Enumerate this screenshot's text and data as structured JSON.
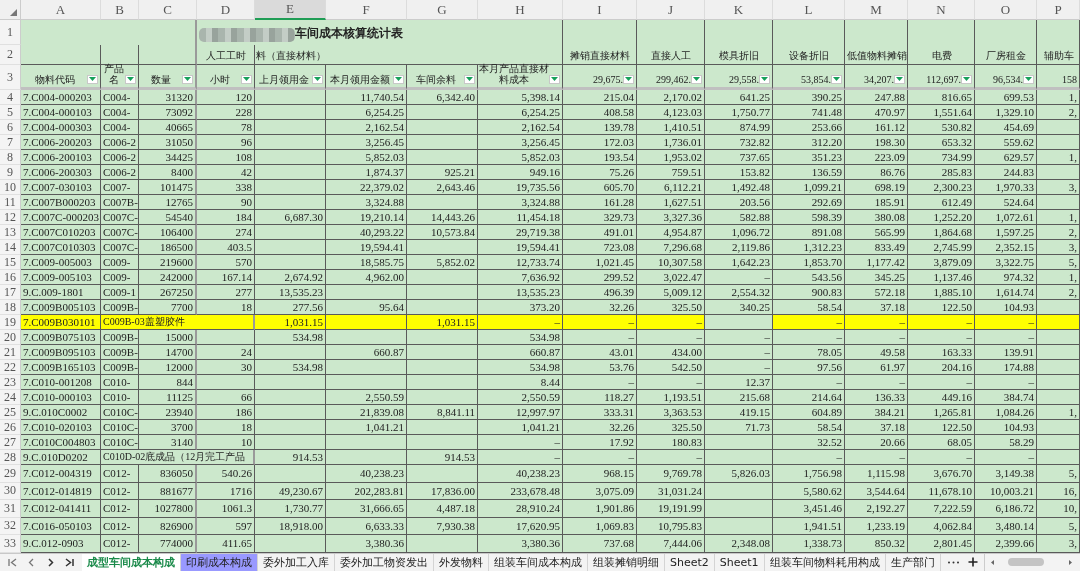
{
  "columns": [
    {
      "label": "A",
      "selected": false
    },
    {
      "label": "B",
      "selected": false
    },
    {
      "label": "C",
      "selected": false
    },
    {
      "label": "D",
      "selected": false
    },
    {
      "label": "E",
      "selected": true
    },
    {
      "label": "F",
      "selected": false
    },
    {
      "label": "G",
      "selected": false
    },
    {
      "label": "H",
      "selected": false
    },
    {
      "label": "I",
      "selected": false
    },
    {
      "label": "J",
      "selected": false
    },
    {
      "label": "K",
      "selected": false
    },
    {
      "label": "L",
      "selected": false
    },
    {
      "label": "M",
      "selected": false
    },
    {
      "label": "N",
      "selected": false
    },
    {
      "label": "O",
      "selected": false
    },
    {
      "label": "P",
      "selected": false
    }
  ],
  "title_row": {
    "number": "1",
    "title": "车间成本核算统计表"
  },
  "group_row": {
    "number": "2",
    "cells": {
      "D": "人工工时",
      "E": "料（直接材料）",
      "I": "摊销直接材料",
      "J": "直接人工",
      "K": "模具折旧",
      "L": "设备折旧",
      "M": "低值物料摊销",
      "N": "电费",
      "O": "厂房租金",
      "P": "辅助车"
    }
  },
  "header_row": {
    "number": "3",
    "cells": {
      "A": {
        "text": "物料代码",
        "filter": true
      },
      "B": {
        "text": "产品名",
        "filter": true
      },
      "C": {
        "text": "数量",
        "filter": true
      },
      "D": {
        "text": "小时",
        "filter": true
      },
      "E": {
        "text": "上月领用金",
        "filter": true
      },
      "F": {
        "text": "本月领用金额",
        "filter": true
      },
      "G": {
        "text": "车间余料",
        "filter": true
      },
      "H": {
        "text": "本月产品直接材料成本",
        "filter": true
      },
      "I": {
        "text": "29,675.",
        "filter": true
      },
      "J": {
        "text": "299,462.",
        "filter": true
      },
      "K": {
        "text": "29,558.",
        "filter": true
      },
      "L": {
        "text": "53,854.",
        "filter": true
      },
      "M": {
        "text": "34,207.",
        "filter": true
      },
      "N": {
        "text": "112,697.",
        "filter": true
      },
      "O": {
        "text": "96,534.",
        "filter": true
      },
      "P": {
        "text": "158",
        "filter": false
      }
    }
  },
  "rows": [
    {
      "number": "4",
      "cells": {
        "A": "7.C004-000203",
        "B": "C004-",
        "C": "31320",
        "D": "120",
        "F": "11,740.54",
        "G": "6,342.40",
        "H": "5,398.14",
        "I": "215.04",
        "J": "2,170.02",
        "K": "641.25",
        "L": "390.25",
        "M": "247.88",
        "N": "816.65",
        "O": "699.53",
        "P": "1,"
      }
    },
    {
      "number": "5",
      "cells": {
        "A": "7.C004-000103",
        "B": "C004-",
        "C": "73092",
        "D": "228",
        "F": "6,254.25",
        "H": "6,254.25",
        "I": "408.58",
        "J": "4,123.03",
        "K": "1,750.77",
        "L": "741.48",
        "M": "470.97",
        "N": "1,551.64",
        "O": "1,329.10",
        "P": "2,"
      }
    },
    {
      "number": "6",
      "cells": {
        "A": "7.C004-000303",
        "B": "C004-",
        "C": "40665",
        "D": "78",
        "F": "2,162.54",
        "H": "2,162.54",
        "I": "139.78",
        "J": "1,410.51",
        "K": "874.99",
        "L": "253.66",
        "M": "161.12",
        "N": "530.82",
        "O": "454.69"
      }
    },
    {
      "number": "7",
      "cells": {
        "A": "7.C006-200203",
        "B": "C006-2",
        "C": "31050",
        "D": "96",
        "F": "3,256.45",
        "H": "3,256.45",
        "I": "172.03",
        "J": "1,736.01",
        "K": "732.82",
        "L": "312.20",
        "M": "198.30",
        "N": "653.32",
        "O": "559.62"
      }
    },
    {
      "number": "8",
      "cells": {
        "A": "7.C006-200103",
        "B": "C006-2",
        "C": "34425",
        "D": "108",
        "F": "5,852.03",
        "H": "5,852.03",
        "I": "193.54",
        "J": "1,953.02",
        "K": "737.65",
        "L": "351.23",
        "M": "223.09",
        "N": "734.99",
        "O": "629.57",
        "P": "1,"
      }
    },
    {
      "number": "9",
      "cells": {
        "A": "7.C006-200303",
        "B": "C006-2",
        "C": "8400",
        "D": "42",
        "F": "1,874.37",
        "G": "925.21",
        "H": "949.16",
        "I": "75.26",
        "J": "759.51",
        "K": "153.82",
        "L": "136.59",
        "M": "86.76",
        "N": "285.83",
        "O": "244.83"
      }
    },
    {
      "number": "10",
      "cells": {
        "A": "7.C007-030103",
        "B": "C007-",
        "C": "101475",
        "D": "338",
        "F": "22,379.02",
        "G": "2,643.46",
        "H": "19,735.56",
        "I": "605.70",
        "J": "6,112.21",
        "K": "1,492.48",
        "L": "1,099.21",
        "M": "698.19",
        "N": "2,300.23",
        "O": "1,970.33",
        "P": "3,"
      }
    },
    {
      "number": "11",
      "cells": {
        "A": "7.C007B000203",
        "B": "C007B-",
        "C": "12765",
        "D": "90",
        "F": "3,324.88",
        "H": "3,324.88",
        "I": "161.28",
        "J": "1,627.51",
        "K": "203.56",
        "L": "292.69",
        "M": "185.91",
        "N": "612.49",
        "O": "524.64"
      }
    },
    {
      "number": "12",
      "cells": {
        "A": "7.C007C-000203",
        "B": "C007C-",
        "C": "54540",
        "D": "184",
        "E": "6,687.30",
        "F": "19,210.14",
        "G": "14,443.26",
        "H": "11,454.18",
        "I": "329.73",
        "J": "3,327.36",
        "K": "582.88",
        "L": "598.39",
        "M": "380.08",
        "N": "1,252.20",
        "O": "1,072.61",
        "P": "1,"
      }
    },
    {
      "number": "13",
      "cells": {
        "A": "7.C007C010203",
        "B": "C007C-",
        "C": "106400",
        "D": "274",
        "F": "40,293.22",
        "G": "10,573.84",
        "H": "29,719.38",
        "I": "491.01",
        "J": "4,954.87",
        "K": "1,096.72",
        "L": "891.08",
        "M": "565.99",
        "N": "1,864.68",
        "O": "1,597.25",
        "P": "2,"
      }
    },
    {
      "number": "14",
      "cells": {
        "A": "7.C007C010303",
        "B": "C007C-",
        "C": "186500",
        "D": "403.5",
        "F": "19,594.41",
        "H": "19,594.41",
        "I": "723.08",
        "J": "7,296.68",
        "K": "2,119.86",
        "L": "1,312.23",
        "M": "833.49",
        "N": "2,745.99",
        "O": "2,352.15",
        "P": "3,"
      }
    },
    {
      "number": "15",
      "cells": {
        "A": "7.C009-005003",
        "B": "C009-",
        "C": "219600",
        "D": "570",
        "F": "18,585.75",
        "G": "5,852.02",
        "H": "12,733.74",
        "I": "1,021.45",
        "J": "10,307.58",
        "K": "1,642.23",
        "L": "1,853.70",
        "M": "1,177.42",
        "N": "3,879.09",
        "O": "3,322.75",
        "P": "5,"
      }
    },
    {
      "number": "16",
      "cells": {
        "A": "7.C009-005103",
        "B": "C009-",
        "C": "242000",
        "D": "167.14",
        "E": "2,674.92",
        "F": "4,962.00",
        "H": "7,636.92",
        "I": "299.52",
        "J": "3,022.47",
        "K": "–",
        "L": "543.56",
        "M": "345.25",
        "N": "1,137.46",
        "O": "974.32",
        "P": "1,"
      }
    },
    {
      "number": "17",
      "cells": {
        "A": "9.C.009-1801",
        "B": "C009-1",
        "C": "267250",
        "D": "277",
        "E": "13,535.23",
        "H": "13,535.23",
        "I": "496.39",
        "J": "5,009.12",
        "K": "2,554.32",
        "L": "900.83",
        "M": "572.18",
        "N": "1,885.10",
        "O": "1,614.74",
        "P": "2,"
      }
    },
    {
      "number": "18",
      "cells": {
        "A": "7.C009B005103",
        "B": "C009B-",
        "C": "7700",
        "D": "18",
        "E": "277.56",
        "F": "95.64",
        "H": "373.20",
        "I": "32.26",
        "J": "325.50",
        "K": "340.25",
        "L": "58.54",
        "M": "37.18",
        "N": "122.50",
        "O": "104.93"
      }
    },
    {
      "number": "19",
      "cells": {
        "A": "7.C009B030101",
        "B": "C009B-03盖塑胶件",
        "E": "1,031.15",
        "G": "1,031.15",
        "H": "–",
        "I": "–",
        "J": "–",
        "L": "–",
        "M": "–",
        "N": "–",
        "O": "–"
      },
      "highlighted_cells": {
        "A": true,
        "B": true,
        "E": true,
        "F": true,
        "G": true,
        "H": true,
        "I": true,
        "J": true,
        "K": false,
        "L": true,
        "M": true,
        "N": true,
        "O": true,
        "P": true
      }
    },
    {
      "number": "20",
      "cells": {
        "A": "7.C009B075103",
        "B": "C009B-",
        "C": "15000",
        "E": "534.98",
        "H": "534.98",
        "I": "–",
        "J": "–",
        "K": "–",
        "L": "–",
        "M": "–",
        "N": "–",
        "O": "–"
      }
    },
    {
      "number": "21",
      "cells": {
        "A": "7.C009B095103",
        "B": "C009B-",
        "C": "14700",
        "D": "24",
        "F": "660.87",
        "H": "660.87",
        "I": "43.01",
        "J": "434.00",
        "K": "–",
        "L": "78.05",
        "M": "49.58",
        "N": "163.33",
        "O": "139.91"
      }
    },
    {
      "number": "22",
      "cells": {
        "A": "7.C009B165103",
        "B": "C009B-",
        "C": "12000",
        "D": "30",
        "E": "534.98",
        "H": "534.98",
        "I": "53.76",
        "J": "542.50",
        "K": "–",
        "L": "97.56",
        "M": "61.97",
        "N": "204.16",
        "O": "174.88"
      }
    },
    {
      "number": "23",
      "cells": {
        "A": "7.C010-001208",
        "B": "C010-",
        "C": "844",
        "H": "8.44",
        "I": "–",
        "J": "–",
        "K": "12.37",
        "L": "–",
        "M": "–",
        "N": "–",
        "O": "–"
      }
    },
    {
      "number": "24",
      "cells": {
        "A": "7.C010-000103",
        "B": "C010-",
        "C": "11125",
        "D": "66",
        "F": "2,550.59",
        "H": "2,550.59",
        "I": "118.27",
        "J": "1,193.51",
        "K": "215.68",
        "L": "214.64",
        "M": "136.33",
        "N": "449.16",
        "O": "384.74"
      }
    },
    {
      "number": "25",
      "cells": {
        "A": "9.C.010C0002",
        "B": "C010C-",
        "C": "23940",
        "D": "186",
        "F": "21,839.08",
        "G": "8,841.11",
        "H": "12,997.97",
        "I": "333.31",
        "J": "3,363.53",
        "K": "419.15",
        "L": "604.89",
        "M": "384.21",
        "N": "1,265.81",
        "O": "1,084.26",
        "P": "1,"
      }
    },
    {
      "number": "26",
      "cells": {
        "A": "7.C010-020103",
        "B": "C010C-",
        "C": "3700",
        "D": "18",
        "F": "1,041.21",
        "H": "1,041.21",
        "I": "32.26",
        "J": "325.50",
        "K": "71.73",
        "L": "58.54",
        "M": "37.18",
        "N": "122.50",
        "O": "104.93"
      }
    },
    {
      "number": "27",
      "cells": {
        "A": "7.C010C004803",
        "B": "C010C-",
        "C": "3140",
        "D": "10",
        "H": "–",
        "I": "17.92",
        "J": "180.83",
        "L": "32.52",
        "M": "20.66",
        "N": "68.05",
        "O": "58.29"
      }
    },
    {
      "number": "28",
      "cells": {
        "A": "9.C.010D0202",
        "B": "C010D-02底成品（12月完工产品",
        "E": "914.53",
        "G": "914.53",
        "H": "–",
        "I": "–",
        "J": "–",
        "L": "–",
        "M": "–",
        "N": "–",
        "O": "–"
      }
    },
    {
      "number": "29",
      "cells": {
        "A": "7.C012-004319",
        "B": "C012-",
        "C": "836050",
        "D": "540.26",
        "F": "40,238.23",
        "H": "40,238.23",
        "I": "968.15",
        "J": "9,769.78",
        "K": "5,826.03",
        "L": "1,756.98",
        "M": "1,115.98",
        "N": "3,676.70",
        "O": "3,149.38",
        "P": "5,"
      }
    },
    {
      "number": "30",
      "cells": {
        "A": "7.C012-014819",
        "B": "C012-",
        "C": "881677",
        "D": "1716",
        "E": "49,230.67",
        "F": "202,283.81",
        "G": "17,836.00",
        "H": "233,678.48",
        "I": "3,075.09",
        "J": "31,031.24",
        "L": "5,580.62",
        "M": "3,544.64",
        "N": "11,678.10",
        "O": "10,003.21",
        "P": "16,"
      }
    },
    {
      "number": "31",
      "cells": {
        "A": "7.C012-041411",
        "B": "C012-",
        "C": "1027800",
        "D": "1061.3",
        "E": "1,730.77",
        "F": "31,666.65",
        "G": "4,487.18",
        "H": "28,910.24",
        "I": "1,901.86",
        "J": "19,191.99",
        "L": "3,451.46",
        "M": "2,192.27",
        "N": "7,222.59",
        "O": "6,186.72",
        "P": "10,"
      }
    },
    {
      "number": "32",
      "cells": {
        "A": "7.C016-050103",
        "B": "C012-",
        "C": "826900",
        "D": "597",
        "E": "18,918.00",
        "F": "6,633.33",
        "G": "7,930.38",
        "H": "17,620.95",
        "I": "1,069.83",
        "J": "10,795.83",
        "L": "1,941.51",
        "M": "1,233.19",
        "N": "4,062.84",
        "O": "3,480.14",
        "P": "5,"
      }
    },
    {
      "number": "33",
      "cells": {
        "A": "9.C.012-0903",
        "B": "C012-",
        "C": "774000",
        "D": "411.65",
        "F": "3,380.36",
        "H": "3,380.36",
        "I": "737.68",
        "J": "7,444.06",
        "K": "2,348.08",
        "L": "1,338.73",
        "M": "850.32",
        "N": "2,801.45",
        "O": "2,399.66",
        "P": "3,"
      }
    }
  ],
  "tabs": [
    {
      "label": "成型车间成本构成",
      "selected": true
    },
    {
      "label": "印刷成本构成",
      "selected": false,
      "color": "#9999ff"
    },
    {
      "label": "委外加工入库",
      "selected": false
    },
    {
      "label": "委外加工物资发出",
      "selected": false
    },
    {
      "label": "外发物料",
      "selected": false
    },
    {
      "label": "组装车间成本构成",
      "selected": false
    },
    {
      "label": "组装摊销明细",
      "selected": false
    },
    {
      "label": "Sheet2",
      "selected": false
    },
    {
      "label": "Sheet1",
      "selected": false
    },
    {
      "label": "组装车间物料耗用构成",
      "selected": false
    },
    {
      "label": "生产部门",
      "selected": false
    }
  ]
}
